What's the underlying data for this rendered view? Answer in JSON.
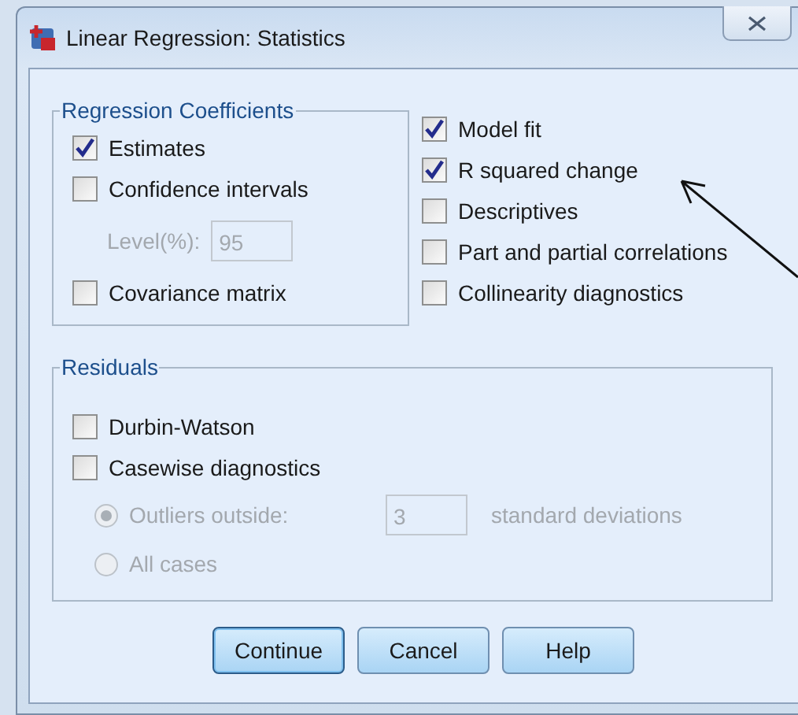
{
  "window": {
    "title": "Linear Regression: Statistics"
  },
  "regression_coefficients": {
    "title": "Regression Coefficients",
    "options": [
      {
        "label": "Estimates",
        "checked": true
      },
      {
        "label": "Confidence intervals",
        "checked": false
      }
    ],
    "level": {
      "label": "Level(%):",
      "value": "95",
      "disabled": true
    },
    "covariance": {
      "label": "Covariance matrix",
      "checked": false
    }
  },
  "options": [
    {
      "label": "Model fit",
      "checked": true
    },
    {
      "label": "R squared change",
      "checked": true
    },
    {
      "label": "Descriptives",
      "checked": false
    },
    {
      "label": "Part and partial correlations",
      "checked": false
    },
    {
      "label": "Collinearity diagnostics",
      "checked": false
    }
  ],
  "residuals": {
    "title": "Residuals",
    "options": [
      {
        "label": "Durbin-Watson",
        "checked": false
      },
      {
        "label": "Casewise diagnostics",
        "checked": false
      }
    ],
    "casewise": [
      {
        "kind": "field",
        "label": "Outliers outside:",
        "selected": true,
        "disabled": true,
        "value": "3",
        "unit": "standard deviations"
      },
      {
        "kind": "plain",
        "label": "All cases",
        "selected": false,
        "disabled": true
      }
    ]
  },
  "buttons": [
    {
      "label": "Continue",
      "default": true
    },
    {
      "label": "Cancel",
      "default": false
    },
    {
      "label": "Help",
      "default": false
    }
  ]
}
